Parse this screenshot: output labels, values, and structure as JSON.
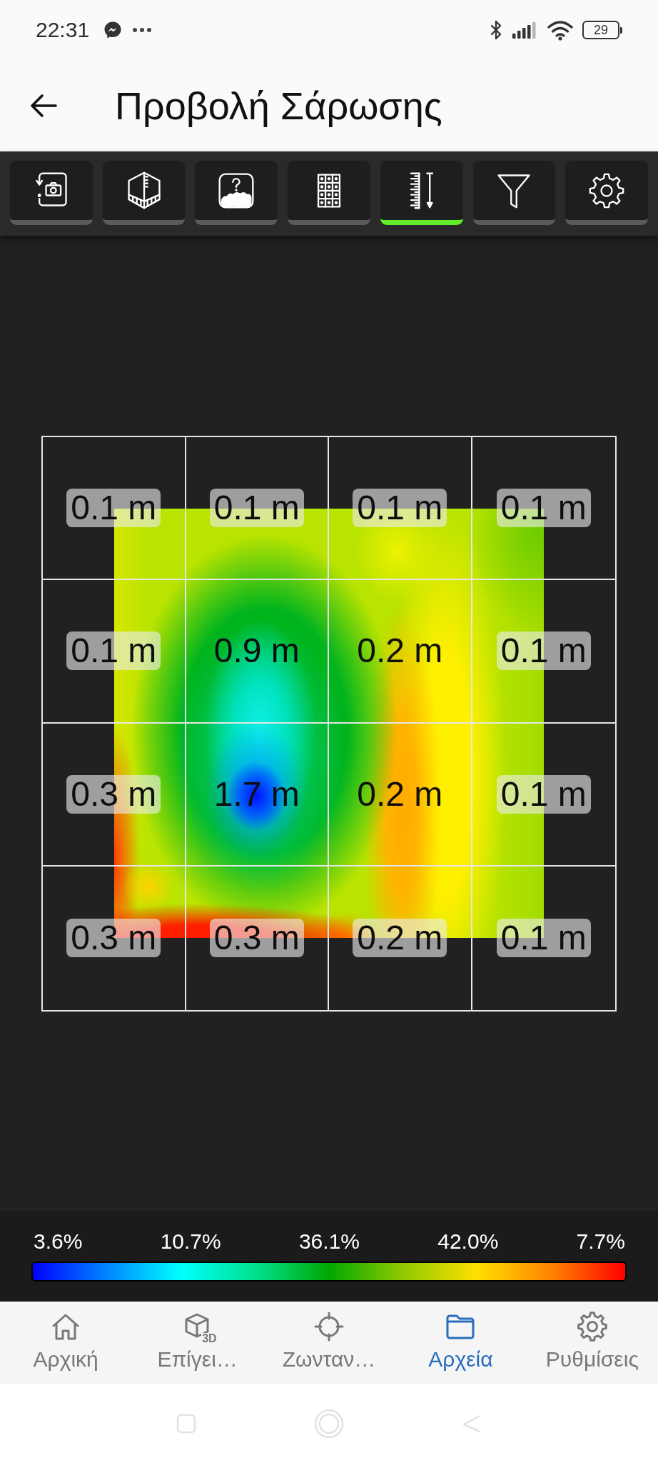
{
  "status_bar": {
    "time": "22:31",
    "battery": "29"
  },
  "header": {
    "title": "Προβολή Σάρωσης"
  },
  "toolbar": [
    {
      "selected": false
    },
    {
      "selected": false
    },
    {
      "selected": false
    },
    {
      "selected": false
    },
    {
      "selected": true
    },
    {
      "selected": false
    },
    {
      "selected": false
    }
  ],
  "depth_grid": {
    "rows": [
      [
        "0.1 m",
        "0.1 m",
        "0.1 m",
        "0.1 m"
      ],
      [
        "0.1 m",
        "0.9 m",
        "0.2 m",
        "0.1 m"
      ],
      [
        "0.3 m",
        "1.7 m",
        "0.2 m",
        "0.1 m"
      ],
      [
        "0.3 m",
        "0.3 m",
        "0.2 m",
        "0.1 m"
      ]
    ]
  },
  "legend": {
    "labels": [
      "3.6%",
      "10.7%",
      "36.1%",
      "42.0%",
      "7.7%"
    ]
  },
  "bottom_nav": [
    {
      "label": "Αρχική",
      "selected": false
    },
    {
      "label": "Επίγει…",
      "icon_text": "3D",
      "selected": false
    },
    {
      "label": "Ζωνταν…",
      "selected": false
    },
    {
      "label": "Αρχεία",
      "selected": true
    },
    {
      "label": "Ρυθμίσεις",
      "selected": false
    }
  ]
}
